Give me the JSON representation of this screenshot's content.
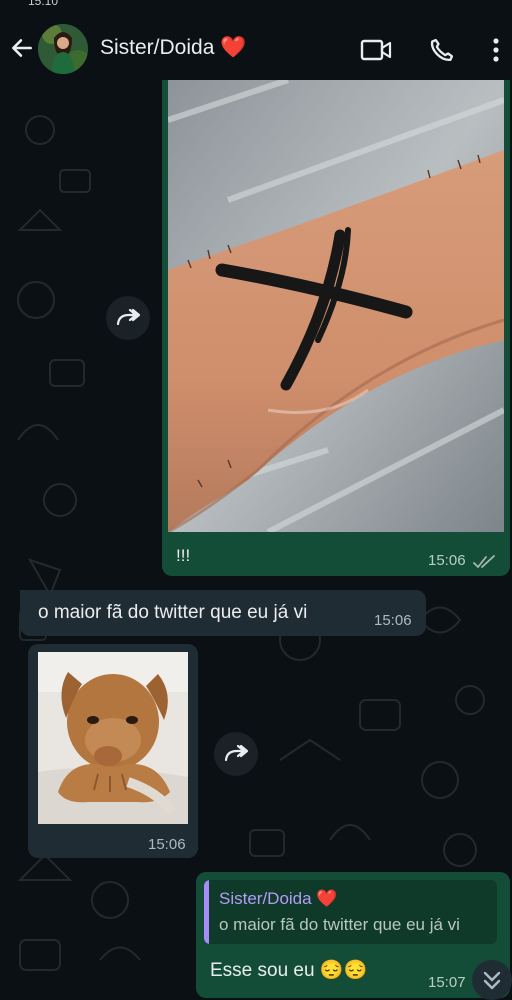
{
  "status_bar": {
    "time": "15:10"
  },
  "header": {
    "contact_name": "Sister/Doida",
    "contact_emoji": "❤️"
  },
  "messages": [
    {
      "type": "image_outgoing",
      "caption": "!!!",
      "time": "15:06",
      "read_status": "read"
    },
    {
      "type": "text_incoming",
      "text": "o maior fã do twitter que eu já vi",
      "time": "15:06"
    },
    {
      "type": "image_incoming",
      "time": "15:06"
    },
    {
      "type": "reply_outgoing",
      "quoted_name": "Sister/Doida",
      "quoted_emoji": "❤️",
      "quoted_text": "o maior fã do twitter que eu já vi",
      "text": "Esse sou eu 😔😔",
      "time": "15:07"
    }
  ],
  "colors": {
    "outgoing_bubble": "#144d37",
    "incoming_bubble": "#202c33",
    "background": "#0b1014",
    "quote_accent": "#a78bfa"
  },
  "icons": {
    "back": "arrow-left-icon",
    "video": "video-call-icon",
    "phone": "phone-call-icon",
    "menu": "more-vertical-icon",
    "forward": "forward-icon",
    "scroll": "double-chevron-down-icon"
  }
}
